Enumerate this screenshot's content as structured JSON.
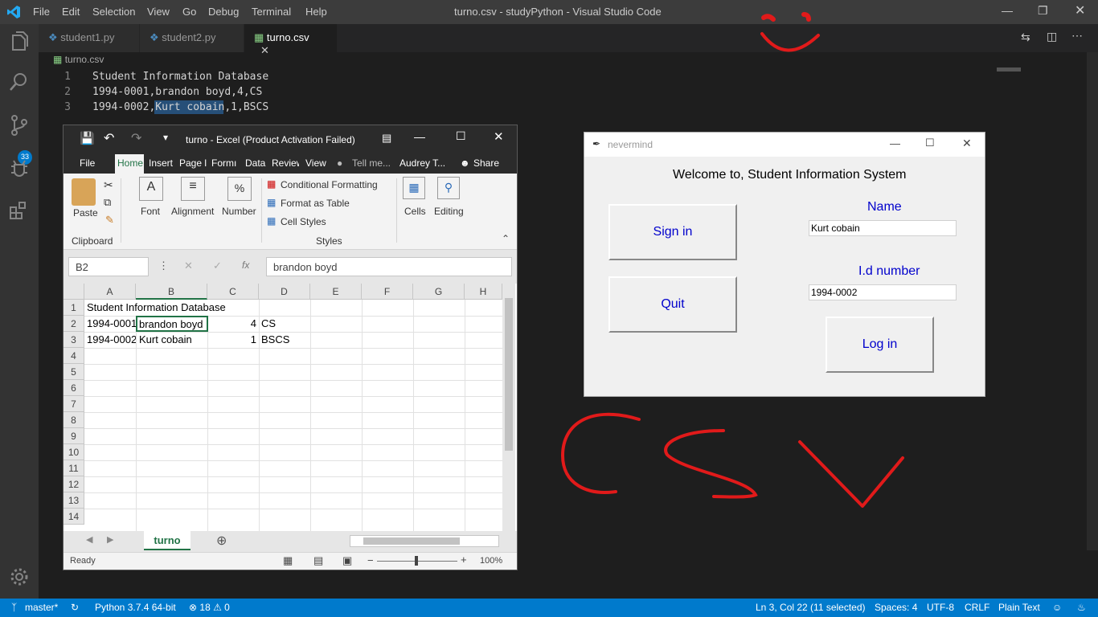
{
  "vscode": {
    "menu": [
      "File",
      "Edit",
      "Selection",
      "View",
      "Go",
      "Debug",
      "Terminal",
      "Help"
    ],
    "window_title": "turno.csv - studyPython - Visual Studio Code",
    "tabs": [
      {
        "label": "student1.py"
      },
      {
        "label": "student2.py"
      },
      {
        "label": "turno.csv"
      }
    ],
    "breadcrumb": "turno.csv",
    "lines": [
      {
        "num": "1",
        "text": "Student Information Database"
      },
      {
        "num": "2",
        "text": "1994-0001,brandon boyd,4,CS"
      },
      {
        "num": "3",
        "text": "1994-0002,Kurt cobain,1,BSCS"
      }
    ],
    "scm_badge": "33",
    "status": {
      "branch": "master*",
      "python": "Python 3.7.4 64-bit",
      "problems": "⊗ 18 ⚠ 0",
      "position": "Ln 3, Col 22 (11 selected)",
      "spaces": "Spaces: 4",
      "encoding": "UTF-8",
      "eol": "CRLF",
      "language": "Plain Text"
    }
  },
  "excel": {
    "title": "turno - Excel (Product Activation Failed)",
    "tabs": [
      "File",
      "Home",
      "Insert",
      "Page l",
      "Formı",
      "Data",
      "Review",
      "View"
    ],
    "tell_me": "Tell me...",
    "user": "Audrey T...",
    "share": "Share",
    "ribbon": {
      "paste": "Paste",
      "clipboard": "Clipboard",
      "font": "Font",
      "alignment": "Alignment",
      "number": "Number",
      "conditional_formatting": "Conditional Formatting",
      "format_as_table": "Format as Table",
      "cell_styles": "Cell Styles",
      "styles": "Styles",
      "cells": "Cells",
      "editing": "Editing"
    },
    "name_box": "B2",
    "formula": "brandon boyd",
    "columns": [
      "A",
      "B",
      "C",
      "D",
      "E",
      "F",
      "G",
      "H"
    ],
    "rows": [
      "1",
      "2",
      "3",
      "4",
      "5",
      "6",
      "7",
      "8",
      "9",
      "10",
      "11",
      "12",
      "13",
      "14"
    ],
    "cells": {
      "a1": "Student Information Database",
      "a2": "1994-0001",
      "b2": "brandon boyd",
      "c2": "4",
      "d2": "CS",
      "a3": "1994-0002",
      "b3": "Kurt cobain",
      "c3": "1",
      "d3": "BSCS"
    },
    "sheet": "turno",
    "status": "Ready",
    "zoom": "100%"
  },
  "tk": {
    "title": "nevermind",
    "welcome": "Welcome to, Student Information System",
    "sign_in": "Sign in",
    "quit": "Quit",
    "name_label": "Name",
    "name_value": "Kurt cobain",
    "id_label": "I.d number",
    "id_value": "1994-0002",
    "login": "Log in"
  }
}
